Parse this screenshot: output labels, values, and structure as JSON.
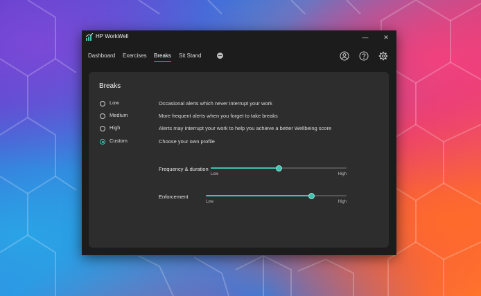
{
  "window": {
    "title": "HP WorkWell",
    "minimize_glyph": "—",
    "close_glyph": "✕"
  },
  "nav": {
    "tabs": [
      {
        "label": "Dashboard",
        "active": false
      },
      {
        "label": "Exercises",
        "active": false
      },
      {
        "label": "Breaks",
        "active": true
      },
      {
        "label": "Sit Stand",
        "active": false
      }
    ],
    "icons": [
      "account-icon",
      "help-icon",
      "settings-icon"
    ]
  },
  "breaks": {
    "title": "Breaks",
    "options": [
      {
        "label": "Low",
        "description": "Occasional alerts which never interrupt your work",
        "selected": false
      },
      {
        "label": "Medium",
        "description": "More frequent alerts when you forget to take breaks",
        "selected": false
      },
      {
        "label": "High",
        "description": "Alerts may interrupt your work to help you achieve a better Wellbeing score",
        "selected": false
      },
      {
        "label": "Custom",
        "description": "Choose your own profile",
        "selected": true
      }
    ],
    "sliders": [
      {
        "label": "Frequency & duration",
        "low_label": "Low",
        "high_label": "High",
        "value": 0.5
      },
      {
        "label": "Enforcement",
        "low_label": "Low",
        "high_label": "High",
        "value": 0.75
      }
    ]
  },
  "colors": {
    "accent": "#3cc3b1",
    "window_bg": "#1c1c1c",
    "panel_bg": "#2d2d2d"
  }
}
